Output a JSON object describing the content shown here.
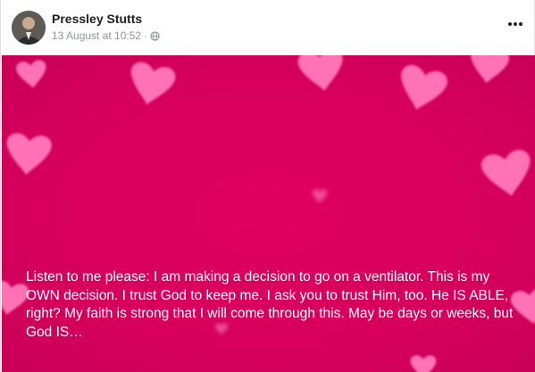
{
  "post": {
    "author": "Pressley Stutts",
    "timestamp": "13 August at 10:52",
    "separator": "·",
    "audience_icon": "globe-icon",
    "menu_icon": "more-options-icon",
    "body_text": "Listen to me please: I am making a decision to go on a ventilator. This is my OWN decision. I trust God to keep me. I ask you to trust Him, too. He IS ABLE, right? My faith is strong that I will come through this. May be days or weeks, but God IS…"
  },
  "colors": {
    "background": "#d6005c",
    "heart": "#ff6fb0",
    "text": "#ffffff",
    "author_text": "#1c1e21",
    "meta_text": "#90949c"
  }
}
